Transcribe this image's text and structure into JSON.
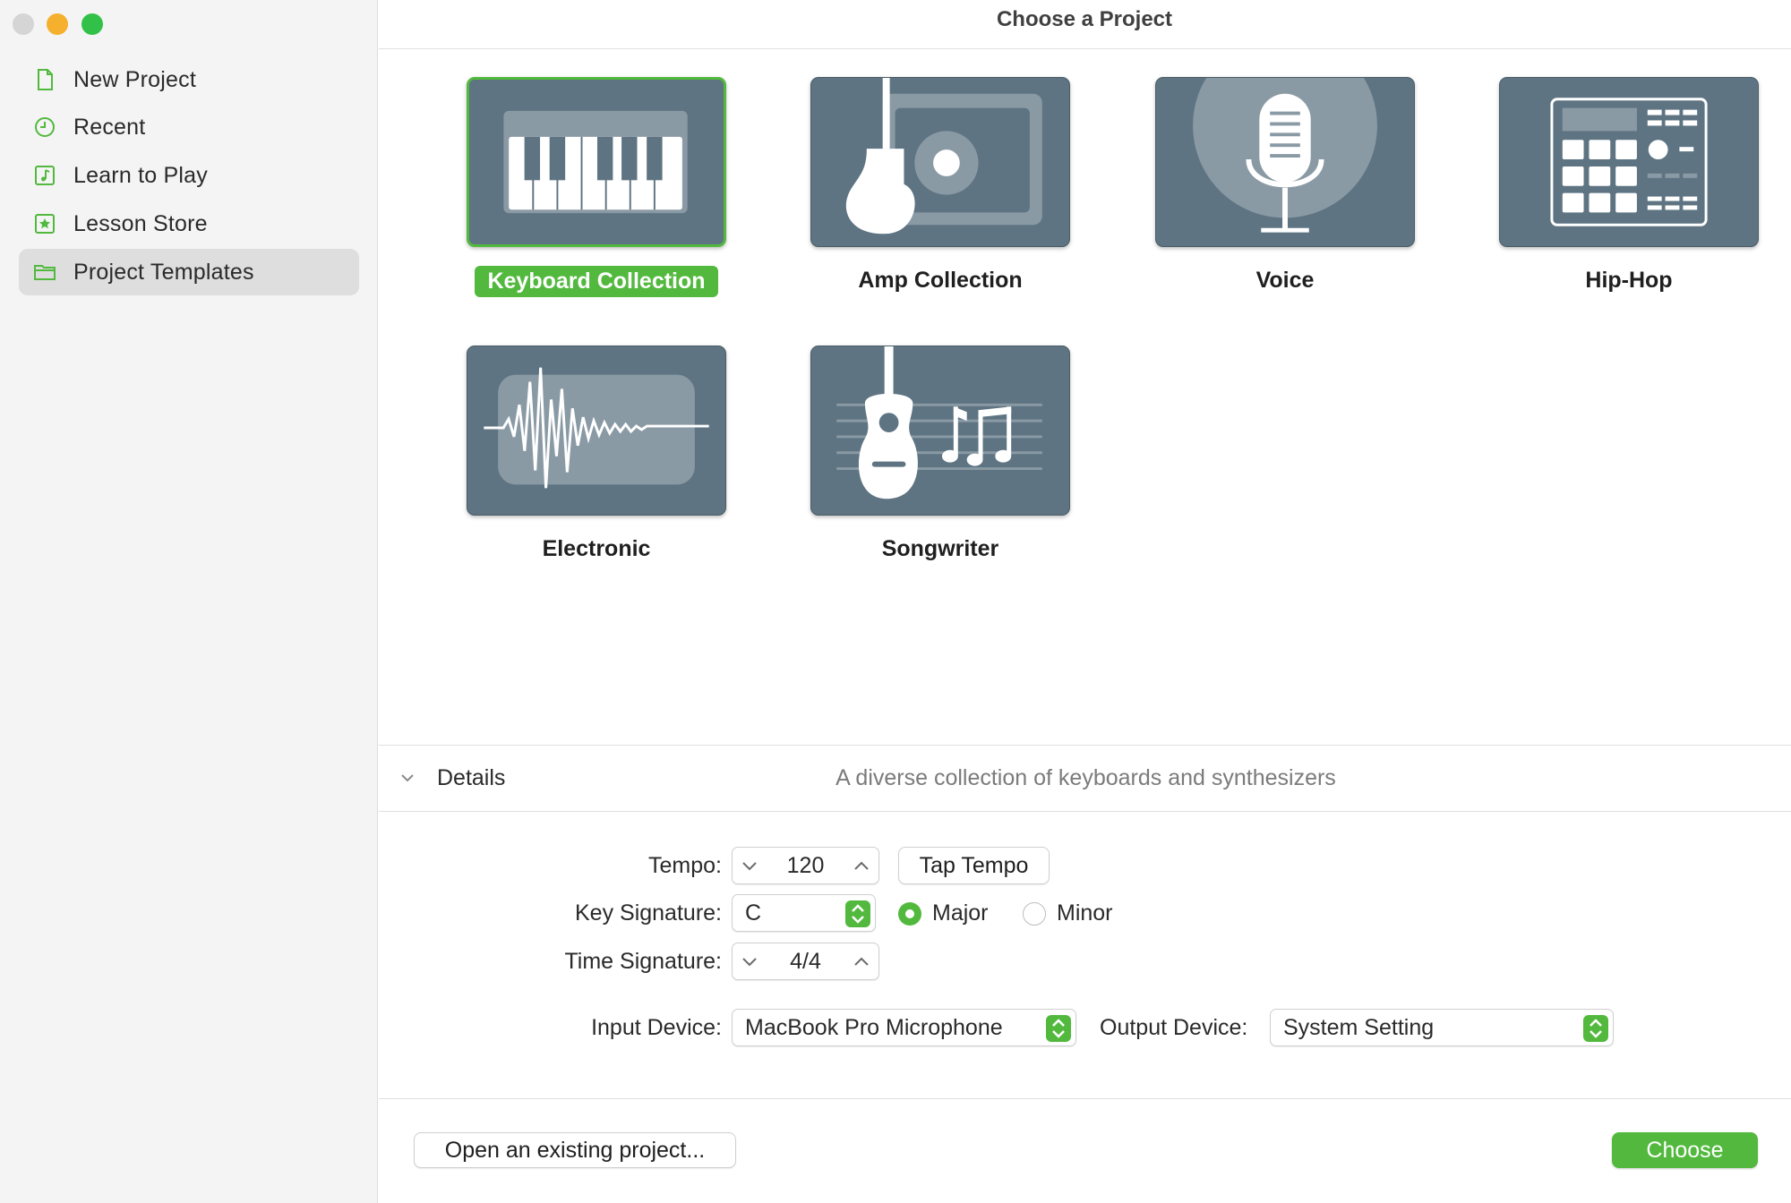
{
  "window": {
    "title": "Choose a Project"
  },
  "traffic_lights": {
    "close": "#d5d5d5",
    "minimize": "#f5b02e",
    "zoom": "#32c148"
  },
  "accent_color": "#52b93e",
  "sidebar": {
    "items": [
      {
        "label": "New Project",
        "icon": "document-icon"
      },
      {
        "label": "Recent",
        "icon": "clock-icon"
      },
      {
        "label": "Learn to Play",
        "icon": "music-note-icon"
      },
      {
        "label": "Lesson Store",
        "icon": "star-icon"
      },
      {
        "label": "Project Templates",
        "icon": "folder-icon",
        "selected": true
      }
    ]
  },
  "templates": [
    {
      "label": "Keyboard Collection",
      "icon": "piano-keyboard-icon",
      "selected": true
    },
    {
      "label": "Amp Collection",
      "icon": "guitar-amp-icon"
    },
    {
      "label": "Voice",
      "icon": "microphone-icon"
    },
    {
      "label": "Hip-Hop",
      "icon": "drum-machine-icon"
    },
    {
      "label": "Electronic",
      "icon": "waveform-icon"
    },
    {
      "label": "Songwriter",
      "icon": "acoustic-guitar-icon"
    }
  ],
  "details": {
    "label": "Details",
    "description": "A diverse collection of keyboards and synthesizers",
    "tempo": {
      "label": "Tempo:",
      "value": "120",
      "tap_label": "Tap Tempo"
    },
    "key_signature": {
      "label": "Key Signature:",
      "value": "C",
      "major_label": "Major",
      "minor_label": "Minor",
      "selected": "Major"
    },
    "time_signature": {
      "label": "Time Signature:",
      "value": "4/4"
    },
    "input_device": {
      "label": "Input Device:",
      "value": "MacBook Pro Microphone"
    },
    "output_device": {
      "label": "Output Device:",
      "value": "System Setting"
    }
  },
  "footer": {
    "open_label": "Open an existing project...",
    "choose_label": "Choose"
  }
}
